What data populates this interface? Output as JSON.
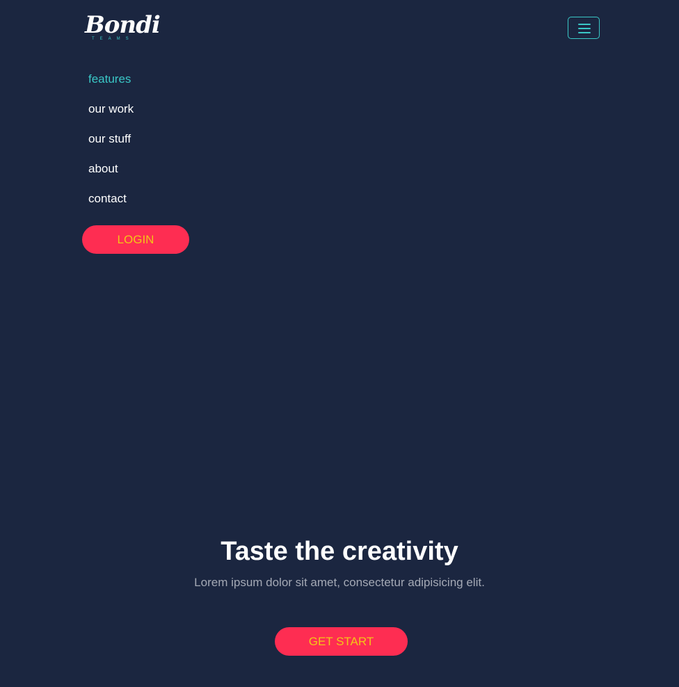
{
  "logo": {
    "name": "Bondi",
    "tagline": "TEAMS"
  },
  "header": {
    "menu_icon": "hamburger-menu-icon"
  },
  "nav": {
    "items": [
      {
        "label": "features",
        "active": true
      },
      {
        "label": "our work",
        "active": false
      },
      {
        "label": "our stuff",
        "active": false
      },
      {
        "label": "about",
        "active": false
      },
      {
        "label": "contact",
        "active": false
      }
    ],
    "login_label": "LOGIN"
  },
  "hero": {
    "title": "Taste the creativity",
    "subtitle": "Lorem ipsum dolor sit amet, consectetur adipisicing elit.",
    "cta_label": "GET START"
  },
  "colors": {
    "background": "#1b2640",
    "accent": "#3ac7c6",
    "button": "#fe2d52",
    "button_text": "#f3c517"
  }
}
